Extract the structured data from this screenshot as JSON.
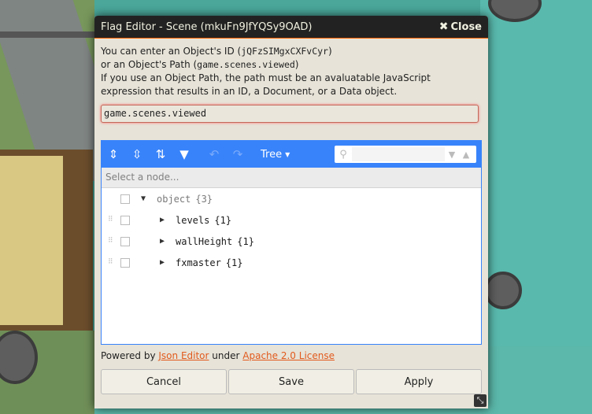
{
  "window": {
    "title": "Flag Editor - Scene (mkuFn9JfYQSy9OAD)",
    "close_label": "Close"
  },
  "instructions": {
    "line1_prefix": "You can enter an Object's ID (",
    "line1_code": "jQFzSIMgxCXFvCyr",
    "line1_suffix": ")",
    "line2_prefix": "or an Object's Path (",
    "line2_code": "game.scenes.viewed",
    "line2_suffix": ")",
    "line3": "If you use an Object Path, the path must be an avaluatable JavaScript expression that results in an ID, a Document, or a Data object."
  },
  "path_input": {
    "value": "game.scenes.viewed"
  },
  "json_editor": {
    "mode_label": "Tree",
    "navigation_placeholder": "Select a node...",
    "tree": [
      {
        "key": "object",
        "meta": "{3}",
        "expanded": true,
        "depth": 0
      },
      {
        "key": "levels",
        "meta": "{1}",
        "expanded": false,
        "depth": 1
      },
      {
        "key": "wallHeight",
        "meta": "{1}",
        "expanded": false,
        "depth": 1
      },
      {
        "key": "fxmaster",
        "meta": "{1}",
        "expanded": false,
        "depth": 1
      }
    ]
  },
  "footer": {
    "powered_by": "Powered by",
    "json_editor_link": "Json Editor",
    "under": "under",
    "license_link": "Apache 2.0 License"
  },
  "buttons": {
    "cancel": "Cancel",
    "save": "Save",
    "apply": "Apply"
  },
  "colors": {
    "accent": "#3883fa",
    "link": "#e25a1c",
    "titlebar": "#222222"
  }
}
